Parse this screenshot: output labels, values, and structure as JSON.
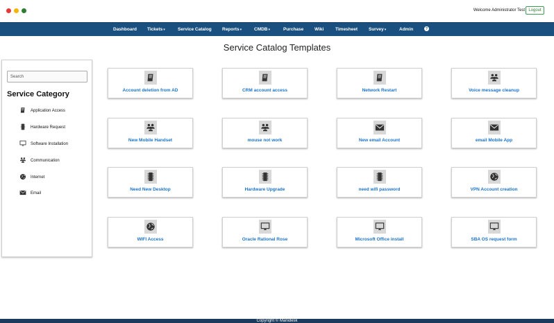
{
  "window": {
    "dot_colors": [
      "#e53935",
      "#f4b400",
      "#2e7d32"
    ]
  },
  "header": {
    "welcome_text": "Welcome Administrator Test",
    "logout_label": "Logout"
  },
  "nav": {
    "items": [
      {
        "label": "Dashboard",
        "has_caret": false
      },
      {
        "label": "Tickets",
        "has_caret": true
      },
      {
        "label": "Service Catalog",
        "has_caret": false
      },
      {
        "label": "Reports",
        "has_caret": true
      },
      {
        "label": "CMDB",
        "has_caret": true
      },
      {
        "label": "Purchase",
        "has_caret": false
      },
      {
        "label": "Wiki",
        "has_caret": false
      },
      {
        "label": "Timesheet",
        "has_caret": false
      },
      {
        "label": "Survey",
        "has_caret": true
      },
      {
        "label": "Admin",
        "has_caret": false
      }
    ],
    "caret": "▾",
    "help_icon": "question-circle-icon",
    "help_glyph": "?"
  },
  "page": {
    "title": "Service Catalog Templates"
  },
  "sidebar": {
    "search_placeholder": "Search",
    "title": "Service Category",
    "items": [
      {
        "label": "Application Access",
        "icon": "book-icon"
      },
      {
        "label": "Hardware Request",
        "icon": "chip-icon"
      },
      {
        "label": "Software Installation",
        "icon": "monitor-icon"
      },
      {
        "label": "Communication",
        "icon": "users-icon"
      },
      {
        "label": "Internet",
        "icon": "globe-icon"
      },
      {
        "label": "Email",
        "icon": "envelope-icon"
      }
    ]
  },
  "catalog": {
    "rows": [
      [
        {
          "label": "Account deletion from AD",
          "icon": "book-icon"
        },
        {
          "label": "CRM account access",
          "icon": "book-icon"
        },
        {
          "label": "Network Restart",
          "icon": "book-icon"
        },
        {
          "label": "Voice message cleanup",
          "icon": "users-icon"
        }
      ],
      [
        {
          "label": "New Mobile Handset",
          "icon": "users-icon"
        },
        {
          "label": "mouse not work",
          "icon": "users-icon"
        },
        {
          "label": "New email Account",
          "icon": "envelope-icon"
        },
        {
          "label": "email Mobile App",
          "icon": "envelope-icon"
        }
      ],
      [
        {
          "label": "Need New Desktop",
          "icon": "chip-icon"
        },
        {
          "label": "Hardware Upgrade",
          "icon": "chip-icon"
        },
        {
          "label": "need wifi password",
          "icon": "chip-icon"
        },
        {
          "label": "VPN Account creation",
          "icon": "globe-icon"
        }
      ],
      [
        {
          "label": "WIFI Access",
          "icon": "globe-icon"
        },
        {
          "label": "Oracle Rational Rose",
          "icon": "monitor-icon"
        },
        {
          "label": "Microsoft Office install",
          "icon": "monitor-icon"
        },
        {
          "label": "SBA OS request form",
          "icon": "monitor-icon"
        }
      ]
    ]
  },
  "footer": {
    "text": "Copyright © Manidesk"
  }
}
